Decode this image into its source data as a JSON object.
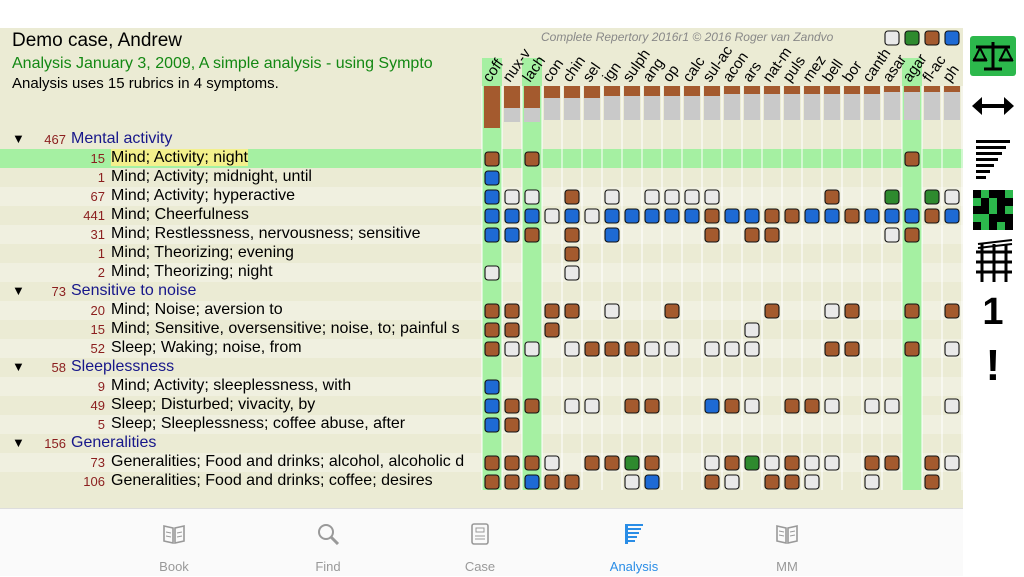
{
  "header": {
    "title": "Demo case, Andrew",
    "analysis_label": "Analysis",
    "analysis_text": "January 3, 2009, A simple analysis - using Sympto",
    "summary": "Analysis uses 15 rubrics in 4 symptoms.",
    "copyright": "Complete Repertory 2016r1 © 2016 Roger van Zandvo"
  },
  "remedies": [
    "coff",
    "nux-v",
    "lach",
    "con",
    "chin",
    "sel",
    "ign",
    "sulph",
    "ang",
    "op",
    "calc",
    "sul-ac",
    "acon",
    "ars",
    "nat-m",
    "puls",
    "mez",
    "bell",
    "bor",
    "canth",
    "asar",
    "agar",
    "fl-ac",
    "ph"
  ],
  "highlighted_columns": [
    0,
    2,
    21
  ],
  "colors": {
    "white": "#e9e9e9",
    "brown": "#a45a2e",
    "blue": "#1e6ad4",
    "green": "#2e8a2e",
    "highlight_green": "#a5f0a2",
    "label_highlight": "#f3f08c",
    "accent_blue": "#2a8de6"
  },
  "rows": [
    {
      "type": "cat",
      "count": "467",
      "label": "Mental activity",
      "cells": ""
    },
    {
      "type": "rub",
      "count": "15",
      "label": "Mind; Activity; night",
      "highlight": true,
      "cells": "r.r..................r.."
    },
    {
      "type": "rub",
      "count": "1",
      "label": "Mind; Activity; midnight, until",
      "cells": "b......................."
    },
    {
      "type": "rub",
      "count": "67",
      "label": "Mind; Activity; hyperactive",
      "cells": "bww.r.w.wwww.....r..g.gwr"
    },
    {
      "type": "rub",
      "count": "441",
      "label": "Mind; Cheerfulness",
      "cells": "bbbwbwbbbbbrbbrrbbrbbbrb"
    },
    {
      "type": "rub",
      "count": "31",
      "label": "Mind; Restlessness, nervousness; sensitive",
      "cells": "bbr.r.b....r.rr.....wr..."
    },
    {
      "type": "rub",
      "count": "1",
      "label": "Mind; Theorizing; evening",
      "cells": "....r..................."
    },
    {
      "type": "rub",
      "count": "2",
      "label": "Mind; Theorizing; night",
      "cells": "w...w..................."
    },
    {
      "type": "cat",
      "count": "73",
      "label": "Sensitive to noise",
      "cells": ""
    },
    {
      "type": "rub",
      "count": "20",
      "label": "Mind; Noise; aversion to",
      "cells": "rr.rr.w..r....r..wr..r.r"
    },
    {
      "type": "rub",
      "count": "15",
      "label": "Mind; Sensitive, oversensitive; noise, to; painful s",
      "cells": "rr.r.........w.........."
    },
    {
      "type": "rub",
      "count": "52",
      "label": "Sleep; Waking; noise, from",
      "cells": "rww.wrrrww.www...rr..r.w"
    },
    {
      "type": "cat",
      "count": "58",
      "label": "Sleeplessness",
      "cells": ""
    },
    {
      "type": "rub",
      "count": "9",
      "label": "Mind; Activity; sleeplessness, with",
      "cells": "b......................."
    },
    {
      "type": "rub",
      "count": "49",
      "label": "Sleep; Disturbed; vivacity, by",
      "cells": "brr.ww.rr..brw.rrw.ww..w"
    },
    {
      "type": "rub",
      "count": "5",
      "label": "Sleep; Sleeplessness; coffee abuse, after",
      "cells": "br......................"
    },
    {
      "type": "cat",
      "count": "156",
      "label": "Generalities",
      "cells": ""
    },
    {
      "type": "rub",
      "count": "73",
      "label": "Generalities; Food and drinks; alcohol, alcoholic d",
      "cells": "rrrw.rrgr..wrgwrww.rr.rwg"
    },
    {
      "type": "rub",
      "count": "106",
      "label": "Generalities; Food and drinks; coffee; desires",
      "cells": "rrbrr..wb..rw.rrw..w..r."
    }
  ],
  "score_bars": [
    {
      "brown": 42,
      "gray": 0
    },
    {
      "brown": 22,
      "gray": 14
    },
    {
      "brown": 22,
      "gray": 14
    },
    {
      "brown": 12,
      "gray": 22
    },
    {
      "brown": 12,
      "gray": 22
    },
    {
      "brown": 12,
      "gray": 22
    },
    {
      "brown": 10,
      "gray": 24
    },
    {
      "brown": 10,
      "gray": 24
    },
    {
      "brown": 10,
      "gray": 24
    },
    {
      "brown": 10,
      "gray": 24
    },
    {
      "brown": 10,
      "gray": 24
    },
    {
      "brown": 10,
      "gray": 24
    },
    {
      "brown": 8,
      "gray": 26
    },
    {
      "brown": 8,
      "gray": 26
    },
    {
      "brown": 8,
      "gray": 26
    },
    {
      "brown": 8,
      "gray": 26
    },
    {
      "brown": 8,
      "gray": 26
    },
    {
      "brown": 8,
      "gray": 26
    },
    {
      "brown": 8,
      "gray": 26
    },
    {
      "brown": 8,
      "gray": 26
    },
    {
      "brown": 6,
      "gray": 28
    },
    {
      "brown": 6,
      "gray": 28
    },
    {
      "brown": 6,
      "gray": 28
    },
    {
      "brown": 6,
      "gray": 28
    }
  ],
  "header_boxes": [
    "white",
    "green",
    "brown",
    "blue"
  ],
  "tabs": [
    {
      "label": "Book",
      "icon": "book-icon"
    },
    {
      "label": "Find",
      "icon": "search-icon"
    },
    {
      "label": "Case",
      "icon": "case-icon"
    },
    {
      "label": "Analysis",
      "icon": "analysis-icon",
      "active": true
    },
    {
      "label": "MM",
      "icon": "materia-medica-icon"
    }
  ],
  "side_tools": [
    {
      "icon": "balance-scale-icon"
    },
    {
      "icon": "horizontal-arrows-icon"
    },
    {
      "icon": "sort-lines-icon"
    },
    {
      "icon": "grid-pattern-icon"
    },
    {
      "icon": "hash-grid-icon"
    },
    {
      "icon": "number-one-icon",
      "text": "1"
    },
    {
      "icon": "exclamation-icon",
      "text": "!"
    }
  ]
}
